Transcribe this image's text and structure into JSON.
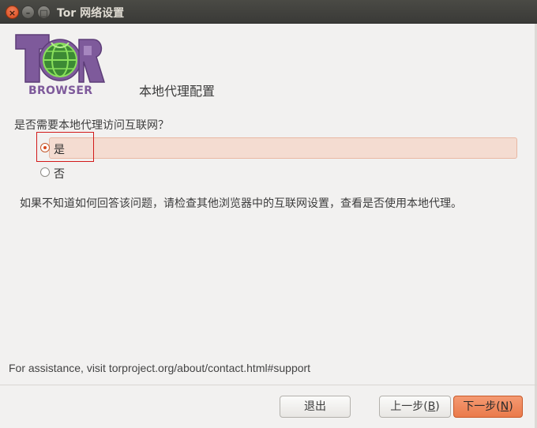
{
  "window": {
    "title": "Tor 网络设置",
    "close_glyph": "×",
    "minimize_glyph": "–",
    "maximize_glyph": "□"
  },
  "logo": {
    "text": "BROWSER",
    "wordmark": "Tor",
    "colors": {
      "purple": "#7e5a9b",
      "green": "#6cc04a"
    }
  },
  "heading": "本地代理配置",
  "question": "是否需要本地代理访问互联网？",
  "options": [
    {
      "label": "是",
      "selected": true
    },
    {
      "label": "否",
      "selected": false
    }
  ],
  "help_text": "如果不知道如何回答该问题，请检查其他浏览器中的互联网设置，查看是否使用本地代理。",
  "assistance": "For assistance, visit torproject.org/about/contact.html#support",
  "buttons": {
    "quit": {
      "label": "退出"
    },
    "back": {
      "label": "上一步(",
      "mnemonic": "B",
      "suffix": ")"
    },
    "next": {
      "label": "下一步(",
      "mnemonic": "N",
      "suffix": ")"
    }
  },
  "colors": {
    "accent": "#ea7a4b",
    "selection_bg": "#f4dcd1",
    "annotation_box": "#d21a1a"
  }
}
